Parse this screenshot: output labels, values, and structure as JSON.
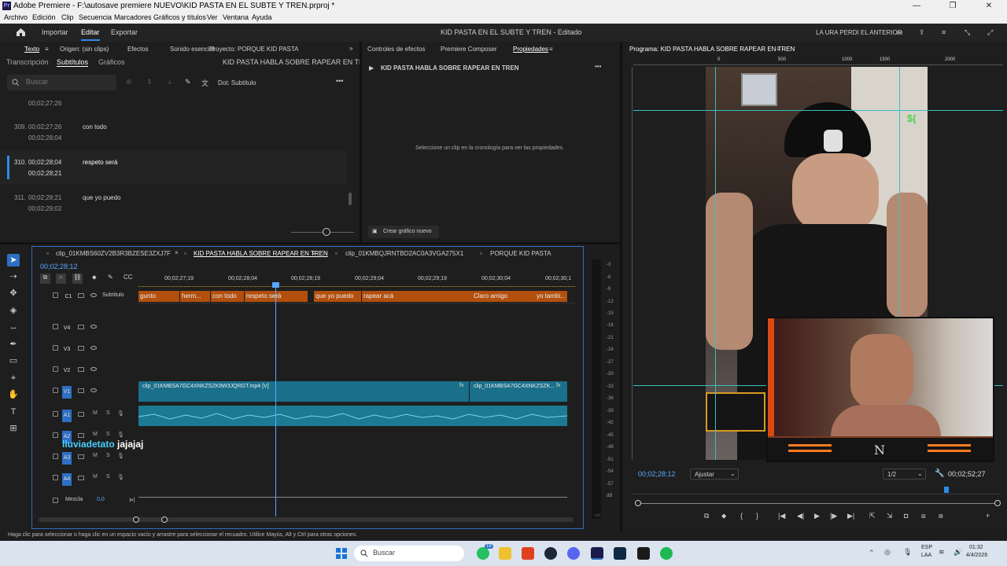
{
  "window": {
    "title": "Adobe Premiere - F:\\autosave premiere NUEVO\\KID PASTA EN EL SUBTE Y TREN.prproj *",
    "logo": "Pr"
  },
  "menu": [
    "Archivo",
    "Edición",
    "Clip",
    "Secuencia",
    "Marcadores",
    "Gráficos y títulos",
    "Ver",
    "Ventana",
    "Ayuda"
  ],
  "topbar": {
    "home": "home-icon",
    "importar": "Importar",
    "editar": "Editar",
    "exportar": "Exportar",
    "center_title": "KID PASTA EN EL SUBTE Y TREN - Editado",
    "right_label": "LA URA PERDI EL ANTERIOR"
  },
  "left_panel": {
    "tabs": [
      "Texto",
      "Origen: (sin clips)",
      "Efectos",
      "Sonido esencial",
      "Proyecto: PORQUE KID PASTA"
    ],
    "subtabs": [
      "Transcripción",
      "Subtítulos",
      "Gráficos"
    ],
    "sequence_name": "KID PASTA HABLA SOBRE RAPEAR EN TREN",
    "search_placeholder": "Buscar",
    "track_label": "Dot: Subtítulo",
    "top_tc": "00;02;27;26",
    "entries": [
      {
        "num": "309.",
        "in": "00;02;27;26",
        "out": "00;02;28;04",
        "text": "con todo"
      },
      {
        "num": "310.",
        "in": "00;02;28;04",
        "out": "00;02;28;21",
        "text": "respeto será"
      },
      {
        "num": "311.",
        "in": "00;02;28;21",
        "out": "00;02;29;02",
        "text": "que yo puedo"
      }
    ]
  },
  "props_panel": {
    "tabs": [
      "Controles de efectos",
      "Premiere Composer",
      "Propiedades"
    ],
    "seq": "KID PASTA HABLA SOBRE RAPEAR EN TREN",
    "message": "Seleccione un clip en la cronología para ver las propiedades.",
    "button": "Crear gráfico nuevo"
  },
  "program": {
    "title": "Programa: KID PASTA HABLA SOBRE RAPEAR EN TREN",
    "ruler": [
      "0",
      "500",
      "1000",
      "1500",
      "2000"
    ],
    "timecode": "00;02;28;12",
    "fit": "Ajustar",
    "quality": "1/2",
    "duration": "00;02;52;27",
    "overlay_text": "$("
  },
  "timeline": {
    "tabs": [
      "clip_01KMBS60ZV2B3R3BZESE3ZXJ7F",
      "KID PASTA HABLA SOBRE RAPEAR EN TREN",
      "clip_01KMBQJRNTBD2AC0A3VGA275X1",
      "PORQUE KID PASTA"
    ],
    "timecode": "00;02;28;12",
    "ruler": [
      "00;02;27;19",
      "00;02;28;04",
      "00;02;28;19",
      "00;02;29;04",
      "00;02;29;19",
      "00;02;30;04",
      "00;02;30;1"
    ],
    "caption_track": "C1",
    "caption_track_label": "Subtítulo",
    "captions": [
      "gunto",
      "herm...",
      "con todo",
      "respeto será",
      "que yo puedo",
      "rapear acá",
      "Claro amigo",
      "yo tambi..."
    ],
    "video_tracks": [
      "V4",
      "V3",
      "V2",
      "V1"
    ],
    "audio_tracks": [
      "A1",
      "A2",
      "A3",
      "A4"
    ],
    "clip1": "clip_01KMBSA7GC4XNKZSZK9W3JQRGT.mp4 [V]",
    "clip2": "clip_01KMBSA7GC4XNKZSZK...",
    "fx": "fx",
    "mix_label": "Mezcla",
    "mix_value": "0,0",
    "overlay_user": "lluviadetato",
    "overlay_msg": "jajajaj"
  },
  "meter": {
    "ticks": [
      "-3",
      "-6",
      "-9",
      "-12",
      "-15",
      "-18",
      "-21",
      "-24",
      "-27",
      "-30",
      "-33",
      "-36",
      "-39",
      "-42",
      "-45",
      "-48",
      "-51",
      "-54",
      "-57",
      "dB"
    ]
  },
  "status": "Haga clic para seleccionar o haga clic en un espacio vacío y arrastre para seleccionar el recuadro. Utilice Mayús, Alt y Ctrl para otras opciones.",
  "taskbar": {
    "search": "Buscar",
    "badge": "19",
    "lang1": "ESP",
    "lang2": "LAA",
    "time": "01:32",
    "date": "4/4/2026"
  },
  "colors": {
    "accent": "#2d8ceb",
    "caption": "#b24f0d",
    "clip": "#1a6f8a",
    "audio": "#1c7a93",
    "overlay_user": "#45d0ff"
  }
}
